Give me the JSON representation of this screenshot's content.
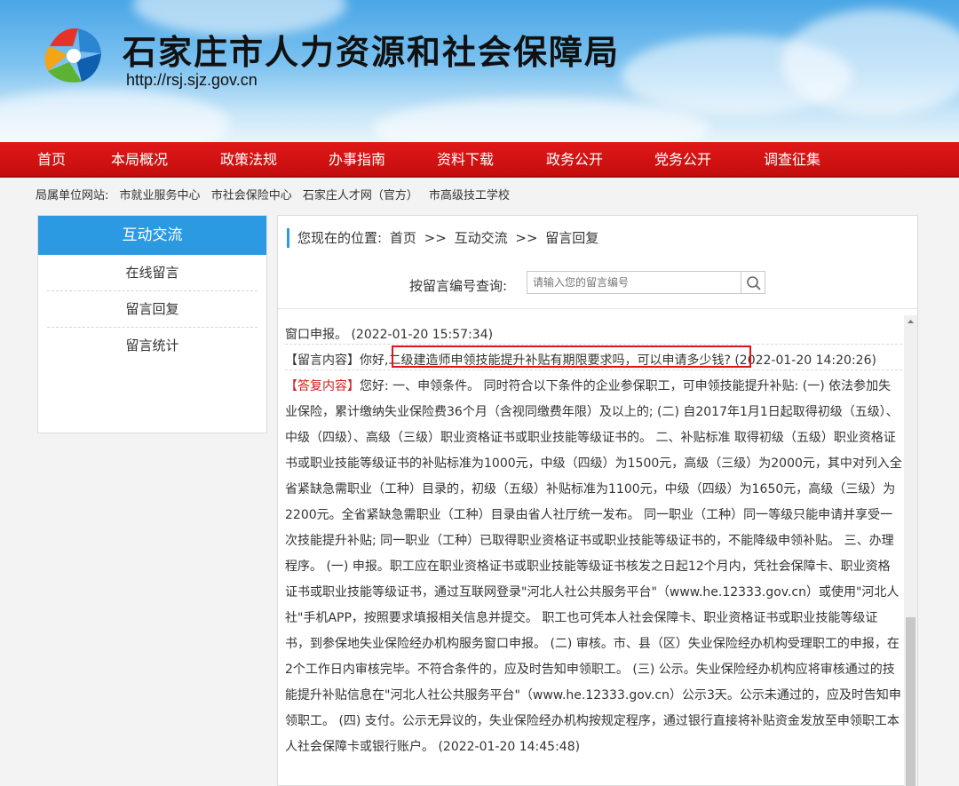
{
  "header": {
    "title": "石家庄市人力资源和社会保障局",
    "url": "http://rsj.sjz.gov.cn"
  },
  "nav": {
    "items": [
      "首页",
      "本局概况",
      "政策法规",
      "办事指南",
      "资料下载",
      "政务公开",
      "党务公开",
      "调查征集"
    ]
  },
  "affiliates": {
    "label": "局属单位网站:",
    "links": [
      "市就业服务中心",
      "市社会保险中心",
      "石家庄人才网（官方）",
      "市高级技工学校"
    ]
  },
  "sidebar": {
    "title": "互动交流",
    "items": [
      "在线留言",
      "留言回复",
      "留言统计"
    ]
  },
  "breadcrumb": {
    "prefix": "您现在的位置:",
    "home": "首页",
    "sep": ">>",
    "level1": "互动交流",
    "level2": "留言回复"
  },
  "query": {
    "label": "按留言编号查询:",
    "placeholder": "请输入您的留言编号"
  },
  "messages": {
    "prev_tail": "窗口申报。 (2022-01-20 15:57:34)",
    "msg_tag": "【留言内容】",
    "msg_greeting": "你好,",
    "msg_question": "二级建造师申领技能提升补贴有期限要求吗，可以申请多少钱?",
    "msg_time": "(2022-01-20 14:20:26)",
    "reply_tag": "【答复内容】",
    "reply_body": "您好: 一、申领条件。  同时符合以下条件的企业参保职工，可申领技能提升补贴: (一) 依法参加失业保险，累计缴纳失业保险费36个月（含视同缴费年限）及以上的; (二) 自2017年1月1日起取得初级（五级）、中级（四级）、高级（三级）职业资格证书或职业技能等级证书的。  二、补贴标准  取得初级（五级）职业资格证书或职业技能等级证书的补贴标准为1000元，中级（四级）为1500元，高级（三级）为2000元，其中对列入全省紧缺急需职业（工种）目录的，初级（五级）补贴标准为1100元，中级（四级）为1650元，高级（三级）为2200元。全省紧缺急需职业（工种）目录由省人社厅统一发布。  同一职业（工种）同一等级只能申请并享受一次技能提升补贴; 同一职业（工种）已取得职业资格证书或职业技能等级证书的，不能降级申领补贴。 三、办理程序。  (一) 申报。职工应在职业资格证书或职业技能等级证书核发之日起12个月内，凭社会保障卡、职业资格证书或职业技能等级证书，通过互联网登录\"河北人社公共服务平台\"（www.he.12333.gov.cn）或使用\"河北人社\"手机APP，按照要求填报相关信息并提交。  职工也可凭本人社会保障卡、职业资格证书或职业技能等级证书，到参保地失业保险经办机构服务窗口申报。 (二) 审核。市、县（区）失业保险经办机构受理职工的申报，在2个工作日内审核完毕。不符合条件的，应及时告知申领职工。  (三) 公示。失业保险经办机构应将审核通过的技能提升补贴信息在\"河北人社公共服务平台\"（www.he.12333.gov.cn）公示3天。公示未通过的，应及时告知申领职工。  (四) 支付。公示无异议的，失业保险经办机构按规定程序，通过银行直接将补贴资金发放至申领职工本人社会保障卡或银行账户。 (2022-01-20 14:45:48)"
  },
  "colors": {
    "nav_red": "#d01010",
    "accent_blue": "#2b9ae2",
    "highlight_red": "#e01414"
  }
}
